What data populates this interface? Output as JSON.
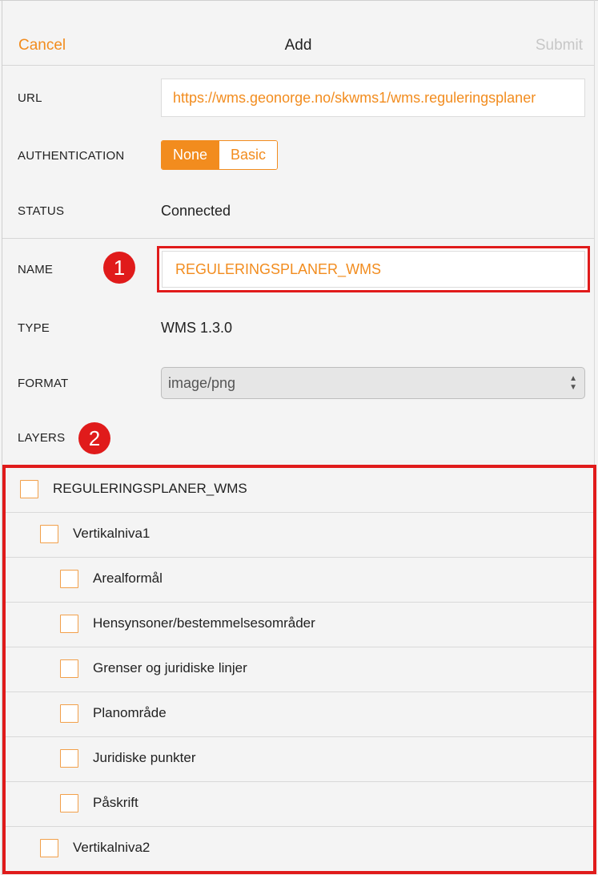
{
  "header": {
    "cancel_label": "Cancel",
    "title": "Add",
    "submit_label": "Submit"
  },
  "form": {
    "url": {
      "label": "URL",
      "value": "https://wms.geonorge.no/skwms1/wms.reguleringsplaner"
    },
    "authentication": {
      "label": "AUTHENTICATION",
      "options": [
        "None",
        "Basic"
      ],
      "selected": "None"
    },
    "status": {
      "label": "STATUS",
      "value": "Connected"
    },
    "name": {
      "label": "NAME",
      "value": "REGULERINGSPLANER_WMS"
    },
    "type": {
      "label": "TYPE",
      "value": "WMS 1.3.0"
    },
    "format": {
      "label": "FORMAT",
      "value": "image/png"
    },
    "layers": {
      "label": "LAYERS"
    }
  },
  "annotations": {
    "badge_1": "1",
    "badge_2": "2"
  },
  "layers": [
    {
      "label": "REGULERINGSPLANER_WMS",
      "level": 0,
      "checked": false
    },
    {
      "label": "Vertikalniva1",
      "level": 1,
      "checked": false
    },
    {
      "label": "Arealformål",
      "level": 2,
      "checked": false
    },
    {
      "label": "Hensynsoner/bestemmelsesområder",
      "level": 2,
      "checked": false
    },
    {
      "label": "Grenser og juridiske linjer",
      "level": 2,
      "checked": false
    },
    {
      "label": "Planområde",
      "level": 2,
      "checked": false
    },
    {
      "label": "Juridiske punkter",
      "level": 2,
      "checked": false
    },
    {
      "label": "Påskrift",
      "level": 2,
      "checked": false
    },
    {
      "label": "Vertikalniva2",
      "level": 1,
      "checked": false
    }
  ],
  "colors": {
    "accent": "#f28c1e",
    "highlight": "#e01b1b",
    "disabled": "#c7c7c7"
  },
  "icons": {
    "format_select": "updown-arrows-icon"
  }
}
